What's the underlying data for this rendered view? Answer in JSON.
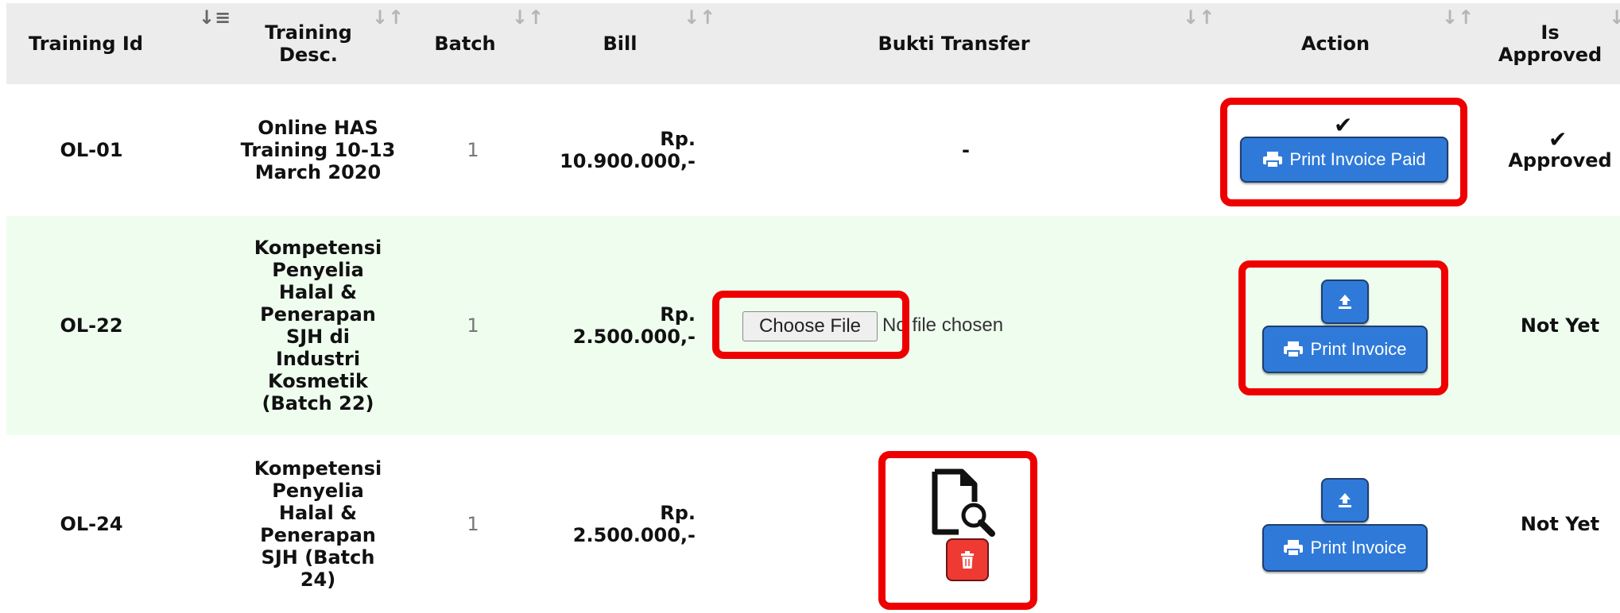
{
  "table": {
    "headers": {
      "training_id": "Training Id",
      "training_desc": "Training Desc.",
      "batch": "Batch",
      "bill": "Bill",
      "bukti_transfer": "Bukti Transfer",
      "action": "Action",
      "is_approved": "Is Approved"
    },
    "sort_icon": "sort-arrows-icon",
    "rows": [
      {
        "training_id": "OL-01",
        "training_desc": "Online HAS Training 10-13 March 2020",
        "batch": "1",
        "bill": "Rp. 10.900.000,-",
        "bukti_transfer": "-",
        "action_check": "✔",
        "action_button": "Print Invoice Paid",
        "approved_check": "✔",
        "is_approved": "Approved"
      },
      {
        "training_id": "OL-22",
        "training_desc": "Kompetensi Penyelia Halal & Penerapan SJH di Industri Kosmetik (Batch 22)",
        "batch": "1",
        "bill": "Rp. 2.500.000,-",
        "file_button": "Choose File",
        "file_status": "No file chosen",
        "action_button": "Print Invoice",
        "is_approved": "Not Yet"
      },
      {
        "training_id": "OL-24",
        "training_desc": "Kompetensi Penyelia Halal & Penerapan SJH (Batch 24)",
        "batch": "1",
        "bill": "Rp. 2.500.000,-",
        "action_button": "Print Invoice",
        "is_approved": "Not Yet"
      }
    ]
  },
  "colors": {
    "header_bg": "#ececec",
    "alt_row_bg": "#effdef",
    "button_blue": "#2f7ad9",
    "highlight_red": "#ee0000",
    "delete_red": "#ef3a34"
  }
}
